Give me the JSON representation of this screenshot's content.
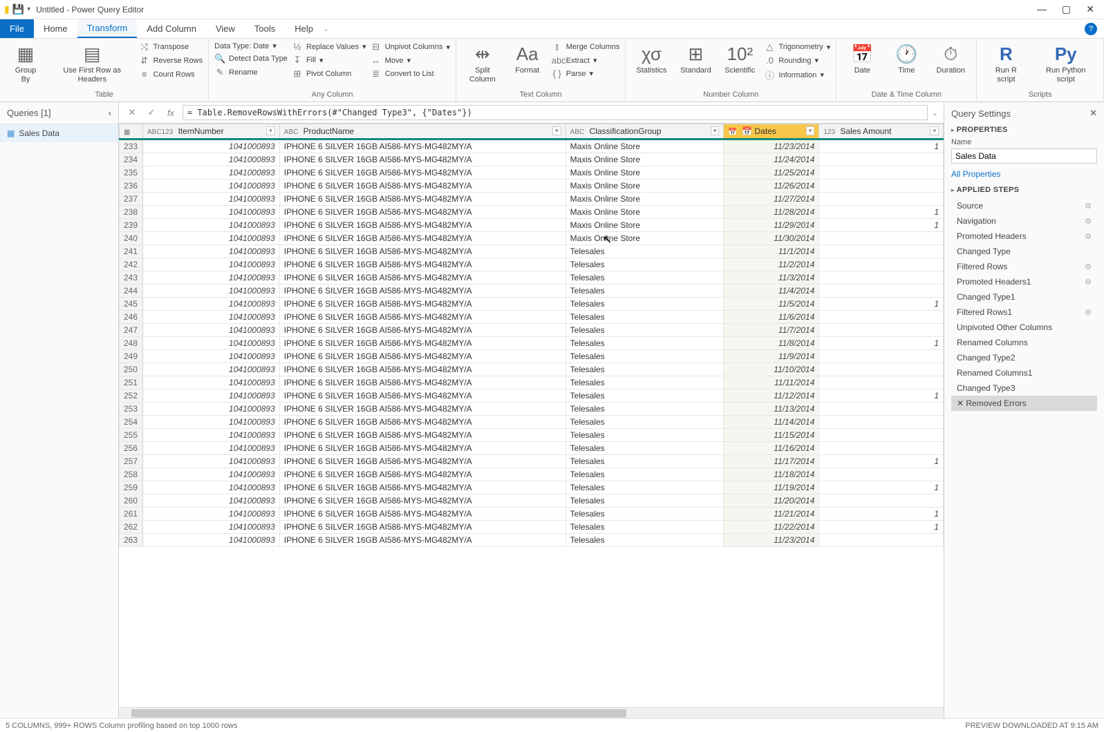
{
  "window": {
    "title": "Untitled - Power Query Editor"
  },
  "menus": [
    "File",
    "Home",
    "Transform",
    "Add Column",
    "View",
    "Tools",
    "Help"
  ],
  "ribbon": {
    "table": {
      "groupBy": "Group\nBy",
      "useFirst": "Use First Row\nas Headers",
      "transpose": "Transpose",
      "reverse": "Reverse Rows",
      "count": "Count Rows",
      "label": "Table"
    },
    "anycol": {
      "dtype": "Data Type: Date",
      "detect": "Detect Data Type",
      "rename": "Rename",
      "replace": "Replace Values",
      "fill": "Fill",
      "pivot": "Pivot Column",
      "unpivot": "Unpivot Columns",
      "move": "Move",
      "tolist": "Convert to List",
      "label": "Any Column"
    },
    "textcol": {
      "split": "Split\nColumn",
      "format": "Format",
      "merge": "Merge Columns",
      "extract": "Extract",
      "parse": "Parse",
      "label": "Text Column"
    },
    "numcol": {
      "stats": "Statistics",
      "standard": "Standard",
      "sci": "Scientific",
      "trig": "Trigonometry",
      "round": "Rounding",
      "info": "Information",
      "label": "Number Column"
    },
    "dtcol": {
      "date": "Date",
      "time": "Time",
      "duration": "Duration",
      "label": "Date & Time Column"
    },
    "scripts": {
      "r": "Run R\nscript",
      "py": "Run Python\nscript",
      "label": "Scripts"
    }
  },
  "queries": {
    "title": "Queries [1]",
    "items": [
      "Sales Data"
    ]
  },
  "formula": "= Table.RemoveRowsWithErrors(#\"Changed Type3\", {\"Dates\"})",
  "columns": [
    {
      "name": "ItemNumber",
      "type": "ABC123"
    },
    {
      "name": "ProductName",
      "type": "ABC"
    },
    {
      "name": "ClassificationGroup",
      "type": "ABC"
    },
    {
      "name": "Dates",
      "type": "📅",
      "sel": true
    },
    {
      "name": "Sales Amount",
      "type": "123"
    }
  ],
  "rows": [
    {
      "r": 233,
      "item": "1041000893",
      "prod": "IPHONE 6 SILVER 16GB AI586-MYS-MG482MY/A",
      "cls": "Maxis Online Store",
      "date": "11/23/2014",
      "amt": "1"
    },
    {
      "r": 234,
      "item": "1041000893",
      "prod": "IPHONE 6 SILVER 16GB AI586-MYS-MG482MY/A",
      "cls": "Maxis Online Store",
      "date": "11/24/2014",
      "amt": ""
    },
    {
      "r": 235,
      "item": "1041000893",
      "prod": "IPHONE 6 SILVER 16GB AI586-MYS-MG482MY/A",
      "cls": "Maxis Online Store",
      "date": "11/25/2014",
      "amt": ""
    },
    {
      "r": 236,
      "item": "1041000893",
      "prod": "IPHONE 6 SILVER 16GB AI586-MYS-MG482MY/A",
      "cls": "Maxis Online Store",
      "date": "11/26/2014",
      "amt": ""
    },
    {
      "r": 237,
      "item": "1041000893",
      "prod": "IPHONE 6 SILVER 16GB AI586-MYS-MG482MY/A",
      "cls": "Maxis Online Store",
      "date": "11/27/2014",
      "amt": ""
    },
    {
      "r": 238,
      "item": "1041000893",
      "prod": "IPHONE 6 SILVER 16GB AI586-MYS-MG482MY/A",
      "cls": "Maxis Online Store",
      "date": "11/28/2014",
      "amt": "1"
    },
    {
      "r": 239,
      "item": "1041000893",
      "prod": "IPHONE 6 SILVER 16GB AI586-MYS-MG482MY/A",
      "cls": "Maxis Online Store",
      "date": "11/29/2014",
      "amt": "1"
    },
    {
      "r": 240,
      "item": "1041000893",
      "prod": "IPHONE 6 SILVER 16GB AI586-MYS-MG482MY/A",
      "cls": "Maxis Online Store",
      "date": "11/30/2014",
      "amt": ""
    },
    {
      "r": 241,
      "item": "1041000893",
      "prod": "IPHONE 6 SILVER 16GB AI586-MYS-MG482MY/A",
      "cls": "Telesales",
      "date": "11/1/2014",
      "amt": ""
    },
    {
      "r": 242,
      "item": "1041000893",
      "prod": "IPHONE 6 SILVER 16GB AI586-MYS-MG482MY/A",
      "cls": "Telesales",
      "date": "11/2/2014",
      "amt": ""
    },
    {
      "r": 243,
      "item": "1041000893",
      "prod": "IPHONE 6 SILVER 16GB AI586-MYS-MG482MY/A",
      "cls": "Telesales",
      "date": "11/3/2014",
      "amt": ""
    },
    {
      "r": 244,
      "item": "1041000893",
      "prod": "IPHONE 6 SILVER 16GB AI586-MYS-MG482MY/A",
      "cls": "Telesales",
      "date": "11/4/2014",
      "amt": ""
    },
    {
      "r": 245,
      "item": "1041000893",
      "prod": "IPHONE 6 SILVER 16GB AI586-MYS-MG482MY/A",
      "cls": "Telesales",
      "date": "11/5/2014",
      "amt": "1"
    },
    {
      "r": 246,
      "item": "1041000893",
      "prod": "IPHONE 6 SILVER 16GB AI586-MYS-MG482MY/A",
      "cls": "Telesales",
      "date": "11/6/2014",
      "amt": ""
    },
    {
      "r": 247,
      "item": "1041000893",
      "prod": "IPHONE 6 SILVER 16GB AI586-MYS-MG482MY/A",
      "cls": "Telesales",
      "date": "11/7/2014",
      "amt": ""
    },
    {
      "r": 248,
      "item": "1041000893",
      "prod": "IPHONE 6 SILVER 16GB AI586-MYS-MG482MY/A",
      "cls": "Telesales",
      "date": "11/8/2014",
      "amt": "1"
    },
    {
      "r": 249,
      "item": "1041000893",
      "prod": "IPHONE 6 SILVER 16GB AI586-MYS-MG482MY/A",
      "cls": "Telesales",
      "date": "11/9/2014",
      "amt": ""
    },
    {
      "r": 250,
      "item": "1041000893",
      "prod": "IPHONE 6 SILVER 16GB AI586-MYS-MG482MY/A",
      "cls": "Telesales",
      "date": "11/10/2014",
      "amt": ""
    },
    {
      "r": 251,
      "item": "1041000893",
      "prod": "IPHONE 6 SILVER 16GB AI586-MYS-MG482MY/A",
      "cls": "Telesales",
      "date": "11/11/2014",
      "amt": ""
    },
    {
      "r": 252,
      "item": "1041000893",
      "prod": "IPHONE 6 SILVER 16GB AI586-MYS-MG482MY/A",
      "cls": "Telesales",
      "date": "11/12/2014",
      "amt": "1"
    },
    {
      "r": 253,
      "item": "1041000893",
      "prod": "IPHONE 6 SILVER 16GB AI586-MYS-MG482MY/A",
      "cls": "Telesales",
      "date": "11/13/2014",
      "amt": ""
    },
    {
      "r": 254,
      "item": "1041000893",
      "prod": "IPHONE 6 SILVER 16GB AI586-MYS-MG482MY/A",
      "cls": "Telesales",
      "date": "11/14/2014",
      "amt": ""
    },
    {
      "r": 255,
      "item": "1041000893",
      "prod": "IPHONE 6 SILVER 16GB AI586-MYS-MG482MY/A",
      "cls": "Telesales",
      "date": "11/15/2014",
      "amt": ""
    },
    {
      "r": 256,
      "item": "1041000893",
      "prod": "IPHONE 6 SILVER 16GB AI586-MYS-MG482MY/A",
      "cls": "Telesales",
      "date": "11/16/2014",
      "amt": ""
    },
    {
      "r": 257,
      "item": "1041000893",
      "prod": "IPHONE 6 SILVER 16GB AI586-MYS-MG482MY/A",
      "cls": "Telesales",
      "date": "11/17/2014",
      "amt": "1"
    },
    {
      "r": 258,
      "item": "1041000893",
      "prod": "IPHONE 6 SILVER 16GB AI586-MYS-MG482MY/A",
      "cls": "Telesales",
      "date": "11/18/2014",
      "amt": ""
    },
    {
      "r": 259,
      "item": "1041000893",
      "prod": "IPHONE 6 SILVER 16GB AI586-MYS-MG482MY/A",
      "cls": "Telesales",
      "date": "11/19/2014",
      "amt": "1"
    },
    {
      "r": 260,
      "item": "1041000893",
      "prod": "IPHONE 6 SILVER 16GB AI586-MYS-MG482MY/A",
      "cls": "Telesales",
      "date": "11/20/2014",
      "amt": ""
    },
    {
      "r": 261,
      "item": "1041000893",
      "prod": "IPHONE 6 SILVER 16GB AI586-MYS-MG482MY/A",
      "cls": "Telesales",
      "date": "11/21/2014",
      "amt": "1"
    },
    {
      "r": 262,
      "item": "1041000893",
      "prod": "IPHONE 6 SILVER 16GB AI586-MYS-MG482MY/A",
      "cls": "Telesales",
      "date": "11/22/2014",
      "amt": "1"
    },
    {
      "r": 263,
      "item": "1041000893",
      "prod": "IPHONE 6 SILVER 16GB AI586-MYS-MG482MY/A",
      "cls": "Telesales",
      "date": "11/23/2014",
      "amt": ""
    }
  ],
  "settings": {
    "title": "Query Settings",
    "properties": "PROPERTIES",
    "nameLabel": "Name",
    "nameValue": "Sales Data",
    "allprops": "All Properties",
    "applied": "APPLIED STEPS",
    "steps": [
      {
        "name": "Source",
        "gear": true
      },
      {
        "name": "Navigation",
        "gear": true
      },
      {
        "name": "Promoted Headers",
        "gear": true
      },
      {
        "name": "Changed Type"
      },
      {
        "name": "Filtered Rows",
        "gear": true
      },
      {
        "name": "Promoted Headers1",
        "gear": true
      },
      {
        "name": "Changed Type1"
      },
      {
        "name": "Filtered Rows1",
        "gear": true
      },
      {
        "name": "Unpivoted Other Columns"
      },
      {
        "name": "Renamed Columns"
      },
      {
        "name": "Changed Type2"
      },
      {
        "name": "Renamed Columns1"
      },
      {
        "name": "Changed Type3"
      },
      {
        "name": "Removed Errors",
        "sel": true,
        "del": true
      }
    ]
  },
  "status": {
    "left": "5 COLUMNS, 999+ ROWS    Column profiling based on top 1000 rows",
    "right": "PREVIEW DOWNLOADED AT 9:15 AM"
  }
}
